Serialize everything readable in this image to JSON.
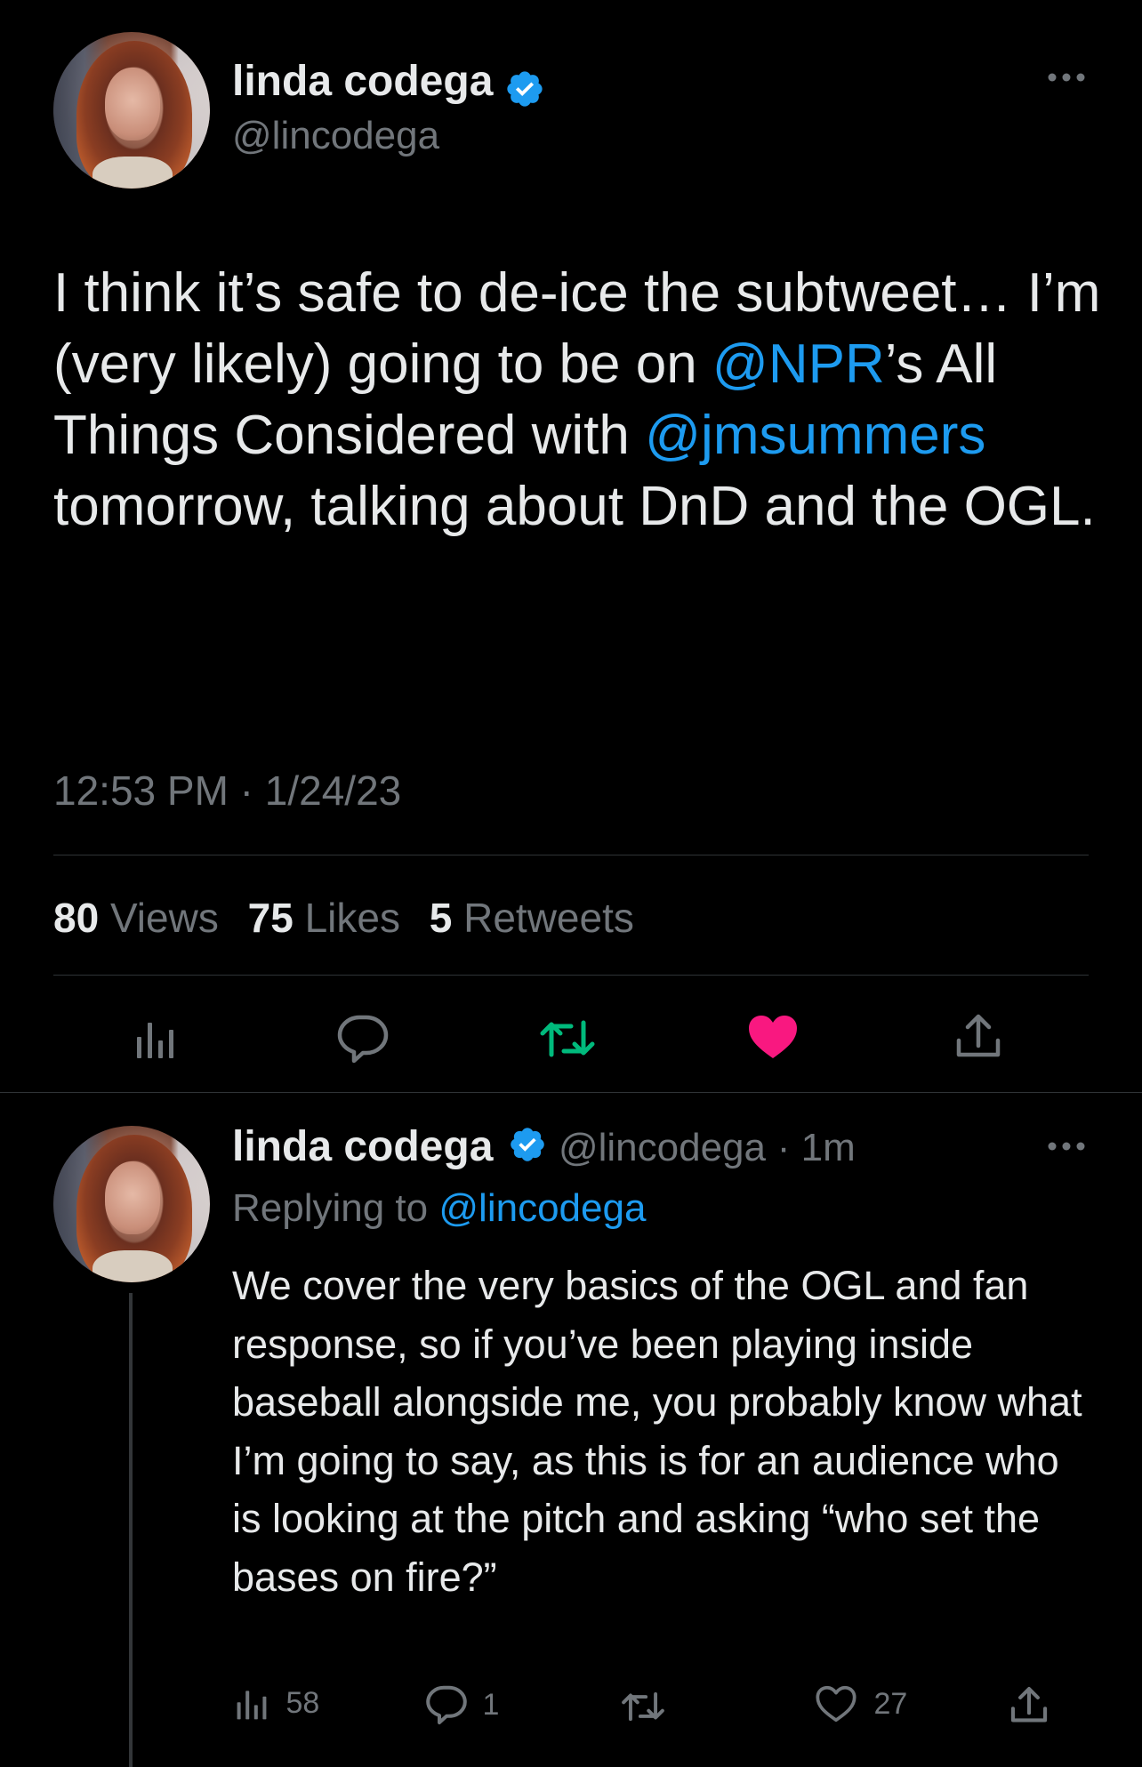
{
  "tweet": {
    "author_name": "linda codega",
    "author_handle": "@lincodega",
    "text_parts": [
      {
        "t": "I think it’s safe to de-ice the subtweet… I’m (very likely) going to be on "
      },
      {
        "t": "@NPR",
        "link": true
      },
      {
        "t": "’s All Things Considered with "
      },
      {
        "t": "@jmsummers",
        "link": true
      },
      {
        "t": " tomorrow, talking about DnD and the OGL."
      }
    ],
    "timestamp": "12:53 PM · 1/24/23",
    "stats": {
      "views_count": "80",
      "views_label": "Views",
      "likes_count": "75",
      "likes_label": "Likes",
      "retweets_count": "5",
      "retweets_label": "Retweets"
    },
    "more_icon": "more-horizontal-icon"
  },
  "reply": {
    "author_name": "linda codega",
    "author_handle": "@lincodega",
    "time": "· 1m",
    "replying_prefix": "Replying to",
    "replying_to": "@lincodega",
    "text": "We cover the very basics of the OGL and fan response, so if you’ve been playing inside baseball alongside me, you probably know what I’m going to say, as this is for an audience who is looking at the pitch and asking “who set the bases on fire?”",
    "views": "58",
    "replies": "1",
    "likes": "27"
  },
  "colors": {
    "background": "#000000",
    "link": "#1d9bf0",
    "verified": "#1d9bf0",
    "retweet_green": "#00ba7c",
    "like_pink": "#f91880",
    "muted": "#71767b"
  }
}
